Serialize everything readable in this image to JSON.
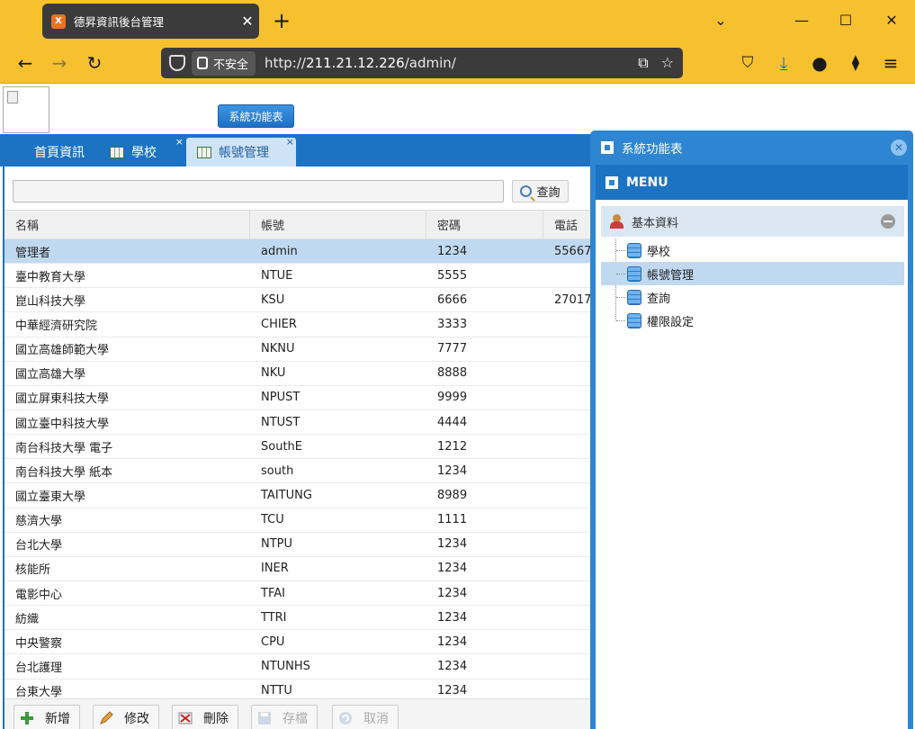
{
  "browser": {
    "tab_title": "德昇資訊後台管理",
    "tab_favicon": "XA",
    "url_insecure_label": "不安全",
    "url_prefix": "http://",
    "url_host": "211.21.12.226",
    "url_path": "/admin/"
  },
  "page": {
    "menu_button": "系統功能表",
    "tabs": [
      {
        "label": "首頁資訊"
      },
      {
        "label": "學校"
      },
      {
        "label": "帳號管理"
      }
    ],
    "search": {
      "value": "",
      "button": "查詢"
    },
    "columns": [
      "名稱",
      "帳號",
      "密碼",
      "電話"
    ],
    "rows": [
      [
        "管理者",
        "admin",
        "1234",
        "55667"
      ],
      [
        "臺中教育大學",
        "NTUE",
        "5555",
        ""
      ],
      [
        "崑山科技大學",
        "KSU",
        "6666",
        "27017"
      ],
      [
        "中華經濟研究院",
        "CHIER",
        "3333",
        ""
      ],
      [
        "國立高雄師範大學",
        "NKNU",
        "7777",
        ""
      ],
      [
        "國立高雄大學",
        "NKU",
        "8888",
        ""
      ],
      [
        "國立屏東科技大學",
        "NPUST",
        "9999",
        ""
      ],
      [
        "國立臺中科技大學",
        "NTUST",
        "4444",
        ""
      ],
      [
        "南台科技大學 電子",
        "SouthE",
        "1212",
        ""
      ],
      [
        "南台科技大學 紙本",
        "south",
        "1234",
        ""
      ],
      [
        "國立臺東大學",
        "TAITUNG",
        "8989",
        ""
      ],
      [
        "慈濟大學",
        "TCU",
        "1111",
        ""
      ],
      [
        "台北大學",
        "NTPU",
        "1234",
        ""
      ],
      [
        "核能所",
        "INER",
        "1234",
        ""
      ],
      [
        "電影中心",
        "TFAI",
        "1234",
        ""
      ],
      [
        "紡織",
        "TTRI",
        "1234",
        ""
      ],
      [
        "中央警察",
        "CPU",
        "1234",
        ""
      ],
      [
        "台北護理",
        "NTUNHS",
        "1234",
        ""
      ],
      [
        "台東大學",
        "NTTU",
        "1234",
        ""
      ]
    ],
    "footer_buttons": [
      "新增",
      "修改",
      "刪除",
      "存檔",
      "取消"
    ]
  },
  "menu_window": {
    "title": "系統功能表",
    "menu_label": "MENU",
    "section": "基本資料",
    "items": [
      "學校",
      "帳號管理",
      "查詢",
      "權限設定"
    ]
  },
  "colors": {
    "chrome": "#f6c02f",
    "accent": "#1c73c4",
    "selected_row": "#c1d9f0"
  }
}
